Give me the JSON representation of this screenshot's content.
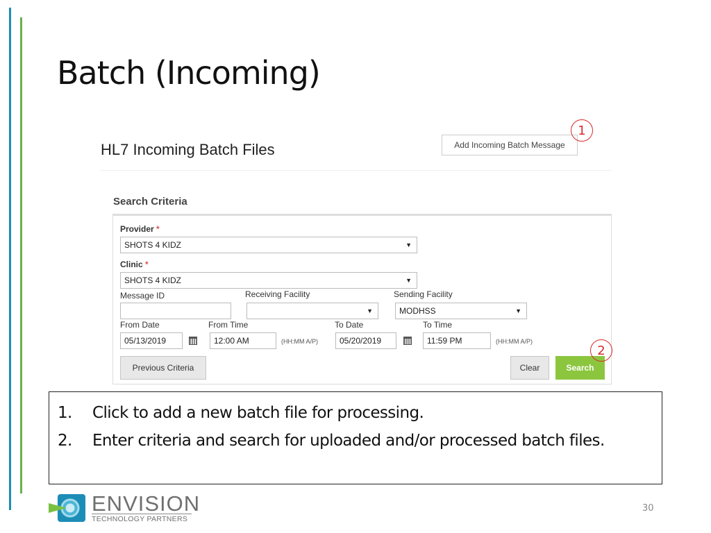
{
  "slide": {
    "title": "Batch (Incoming)",
    "page_number": "30",
    "accent_colors": {
      "blue": "#1a8fb5",
      "green": "#6ab04c"
    }
  },
  "app": {
    "title": "HL7 Incoming Batch Files",
    "add_button_label": "Add Incoming Batch Message",
    "search_section_label": "Search Criteria",
    "form": {
      "provider": {
        "label": "Provider",
        "required_mark": "*",
        "value": "SHOTS 4 KIDZ"
      },
      "clinic": {
        "label": "Clinic",
        "required_mark": "*",
        "value": "SHOTS 4 KIDZ"
      },
      "message_id": {
        "label": "Message ID",
        "value": ""
      },
      "receiving_facility": {
        "label": "Receiving Facility",
        "value": ""
      },
      "sending_facility": {
        "label": "Sending Facility",
        "value": "MODHSS"
      },
      "from_date": {
        "label": "From Date",
        "value": "05/13/2019"
      },
      "from_time": {
        "label": "From Time",
        "value": "12:00 AM",
        "hint": "(HH:MM A/P)"
      },
      "to_date": {
        "label": "To Date",
        "value": "05/20/2019"
      },
      "to_time": {
        "label": "To Time",
        "value": "11:59 PM",
        "hint": "(HH:MM A/P)"
      },
      "caret": "▼"
    },
    "buttons": {
      "previous_criteria": "Previous Criteria",
      "clear": "Clear",
      "search": "Search"
    },
    "colors": {
      "search_button": "#8cc63f",
      "required": "#d9534f"
    }
  },
  "callouts": [
    {
      "number": "1",
      "color": "#d62a2a"
    },
    {
      "number": "2",
      "color": "#d62a2a"
    }
  ],
  "notes": [
    {
      "number": "1.",
      "text": "Click to add a new batch file for processing."
    },
    {
      "number": "2.",
      "text": "Enter criteria and search for uploaded and/or processed batch files."
    }
  ],
  "logo": {
    "name": "ENVISION",
    "tagline": "TECHNOLOGY PARTNERS"
  }
}
